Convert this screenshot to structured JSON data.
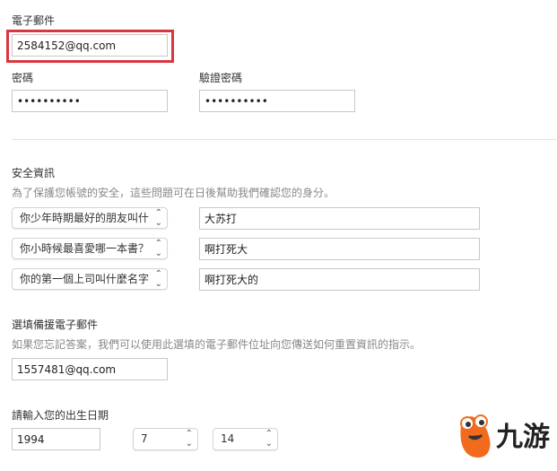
{
  "email": {
    "label": "電子郵件",
    "value": "2584152@qq.com",
    "highlight_color": "#d9363e"
  },
  "password": {
    "label": "密碼",
    "value": "••••••••••"
  },
  "confirm_password": {
    "label": "驗證密碼",
    "value": "••••••••••"
  },
  "security": {
    "title": "安全資訊",
    "description": "為了保護您帳號的安全，這些問題可在日後幫助我們確認您的身分。",
    "questions": [
      {
        "question": "你少年時期最好的朋友叫什",
        "answer": "大苏打"
      },
      {
        "question": "你小時候最喜愛哪一本書？",
        "answer": "啊打死大"
      },
      {
        "question": "你的第一個上司叫什麼名字",
        "answer": "啊打死大的"
      }
    ]
  },
  "backup_email": {
    "label": "選填備援電子郵件",
    "description": "如果您忘記答案，我們可以使用此選填的電子郵件位址向您傳送如何重置資訊的指示。",
    "value": "1557481@qq.com"
  },
  "birthday": {
    "label": "請輸入您的出生日期",
    "year": "1994",
    "month": "7",
    "day": "14"
  },
  "watermark": {
    "text": "九游",
    "color": "#f26b1d"
  }
}
